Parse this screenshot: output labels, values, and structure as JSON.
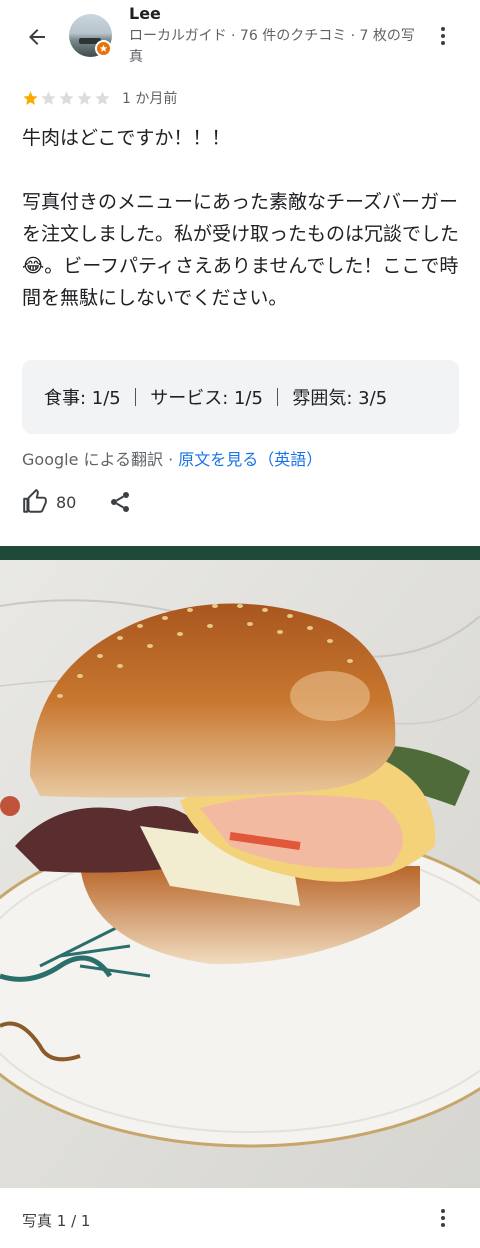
{
  "reviewer": {
    "name": "Lee",
    "meta": "ローカルガイド · 76 件のクチコミ · 7 枚の写真"
  },
  "review": {
    "rating": 1,
    "max_rating": 5,
    "time": "1 か月前",
    "text": "牛肉はどこですか！！！\n\n写真付きのメニューにあった素敵なチーズバーガーを注文しました。私が受け取ったものは冗談でした😂。ビーフパティさえありませんでした！ここで時間を無駄にしないでください。",
    "scores": "食事: 1/5 ｜ サービス: 1/5 ｜ 雰囲気: 3/5",
    "translated_by": "Google による翻訳 · ",
    "original_link": "原文を見る（英語）",
    "likes": "80"
  },
  "photo_footer": {
    "counter": "写真 1 / 1"
  },
  "icons": {
    "back": "back-arrow-icon",
    "more": "more-vert-icon",
    "like": "thumb-up-icon",
    "share": "share-icon",
    "badge": "local-guide-star-icon"
  },
  "colors": {
    "star_filled": "#f9ab00",
    "star_empty": "#dadce0",
    "link": "#1a73e8",
    "badge": "#e8710a"
  }
}
